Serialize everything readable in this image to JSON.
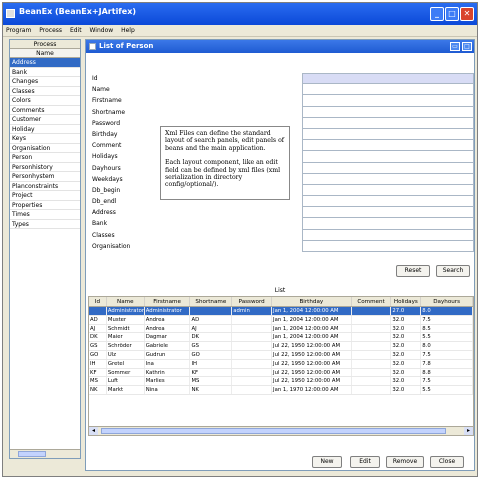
{
  "window": {
    "title": "BeanEx (BeanEx+JArtifex)"
  },
  "menu": [
    "Program",
    "Process",
    "Edit",
    "Window",
    "Help"
  ],
  "sidebar": {
    "header": "Process",
    "column": "Name",
    "items": [
      "Address",
      "Bank",
      "Changes",
      "Classes",
      "Colors",
      "Comments",
      "Customer",
      "Holiday",
      "Keys",
      "Organisation",
      "Person",
      "Personhistory",
      "Personhystem",
      "Planconstraints",
      "Project",
      "Properties",
      "Times",
      "Types"
    ]
  },
  "inner": {
    "title": "List of Person"
  },
  "form": {
    "labels": [
      "Id",
      "Name",
      "Firstname",
      "Shortname",
      "Password",
      "Birthday",
      "Comment",
      "Holidays",
      "Dayhours",
      "Weekdays",
      "Db_begin",
      "Db_endl",
      "Address",
      "Bank",
      "Classes",
      "Organisation"
    ],
    "reset_label": "Reset",
    "search_label": "Search"
  },
  "note": {
    "para1": "Xml Files can define the standard layout of search panels, edit panels of beans and the main application.",
    "para2": "Each layout component, like an edit field can be defined by xml files (xml serialization in directory config/optional/)."
  },
  "list": {
    "caption": "List",
    "columns": [
      "Id",
      "Name",
      "Firstname",
      "Shortname",
      "Password",
      "Birthday",
      "Comment",
      "Holidays",
      "Dayhours"
    ],
    "rows": [
      [
        "",
        "Administrator",
        "Administrator",
        "",
        "admin",
        "Jan 1, 2004 12:00:00 AM",
        "",
        "27.0",
        "8.0"
      ],
      [
        "AD",
        "Muster",
        "Andrea",
        "AD",
        "",
        "Jan 1, 2004 12:00:00 AM",
        "",
        "32.0",
        "7.5"
      ],
      [
        "AJ",
        "Schmidt",
        "Andrea",
        "AJ",
        "",
        "Jan 1, 2004 12:00:00 AM",
        "",
        "32.0",
        "8.5"
      ],
      [
        "DK",
        "Maier",
        "Dagmar",
        "DK",
        "",
        "Jan 1, 2004 12:00:00 AM",
        "",
        "32.0",
        "5.5"
      ],
      [
        "GS",
        "Schröder",
        "Gabriele",
        "GS",
        "",
        "Jul 22, 1950 12:00:00 AM",
        "",
        "32.0",
        "8.0"
      ],
      [
        "GO",
        "Ulz",
        "Gudrun",
        "GO",
        "",
        "Jul 22, 1950 12:00:00 AM",
        "",
        "32.0",
        "7.5"
      ],
      [
        "IH",
        "Gretel",
        "Ina",
        "IH",
        "",
        "Jul 22, 1950 12:00:00 AM",
        "",
        "32.0",
        "7.8"
      ],
      [
        "KF",
        "Sommer",
        "Kathrin",
        "KF",
        "",
        "Jul 22, 1950 12:00:00 AM",
        "",
        "32.0",
        "8.8"
      ],
      [
        "MS",
        "Luft",
        "Marlies",
        "MS",
        "",
        "Jul 22, 1950 12:00:00 AM",
        "",
        "32.0",
        "7.5"
      ],
      [
        "NK",
        "Markt",
        "Nina",
        "NK",
        "",
        "Jan 1, 1970 12:00:00 AM",
        "",
        "32.0",
        "5.5"
      ]
    ],
    "buttons": {
      "new": "New",
      "edit": "Edit",
      "remove": "Remove",
      "close": "Close"
    }
  }
}
